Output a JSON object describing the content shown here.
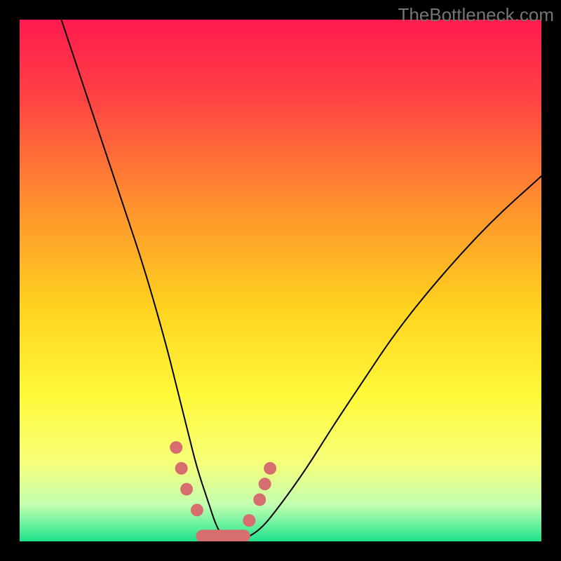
{
  "watermark": "TheBottleneck.com",
  "chart_data": {
    "type": "line",
    "title": "",
    "xlabel": "",
    "ylabel": "",
    "xlim": [
      0,
      100
    ],
    "ylim": [
      0,
      100
    ],
    "grid": false,
    "legend": false,
    "background_gradient": {
      "stops": [
        {
          "offset": 0.0,
          "color": "#ff1a4f"
        },
        {
          "offset": 0.15,
          "color": "#ff4244"
        },
        {
          "offset": 0.35,
          "color": "#ff8f2e"
        },
        {
          "offset": 0.55,
          "color": "#ffd21f"
        },
        {
          "offset": 0.72,
          "color": "#fff93a"
        },
        {
          "offset": 0.85,
          "color": "#f6ff7a"
        },
        {
          "offset": 0.93,
          "color": "#c3ffb0"
        },
        {
          "offset": 0.97,
          "color": "#64f09e"
        },
        {
          "offset": 1.0,
          "color": "#1fe08a"
        }
      ]
    },
    "series": [
      {
        "name": "bottleneck-curve",
        "x": [
          8,
          12,
          16,
          20,
          24,
          28,
          30,
          32,
          34,
          36,
          38,
          40,
          42,
          46,
          50,
          55,
          60,
          66,
          72,
          80,
          90,
          100
        ],
        "y": [
          100,
          88,
          76,
          64,
          52,
          38,
          30,
          22,
          14,
          8,
          2,
          0,
          0,
          2,
          7,
          14,
          22,
          31,
          40,
          50,
          61,
          70
        ]
      }
    ],
    "markers": {
      "name": "highlight-dots",
      "color": "#d66d6f",
      "points": [
        {
          "x": 30,
          "y": 18
        },
        {
          "x": 31,
          "y": 14
        },
        {
          "x": 32,
          "y": 10
        },
        {
          "x": 34,
          "y": 6
        },
        {
          "x": 44,
          "y": 4
        },
        {
          "x": 46,
          "y": 8
        },
        {
          "x": 47,
          "y": 11
        },
        {
          "x": 48,
          "y": 14
        }
      ],
      "flat_segment": {
        "x0": 35,
        "x1": 43,
        "y": 1
      }
    }
  }
}
